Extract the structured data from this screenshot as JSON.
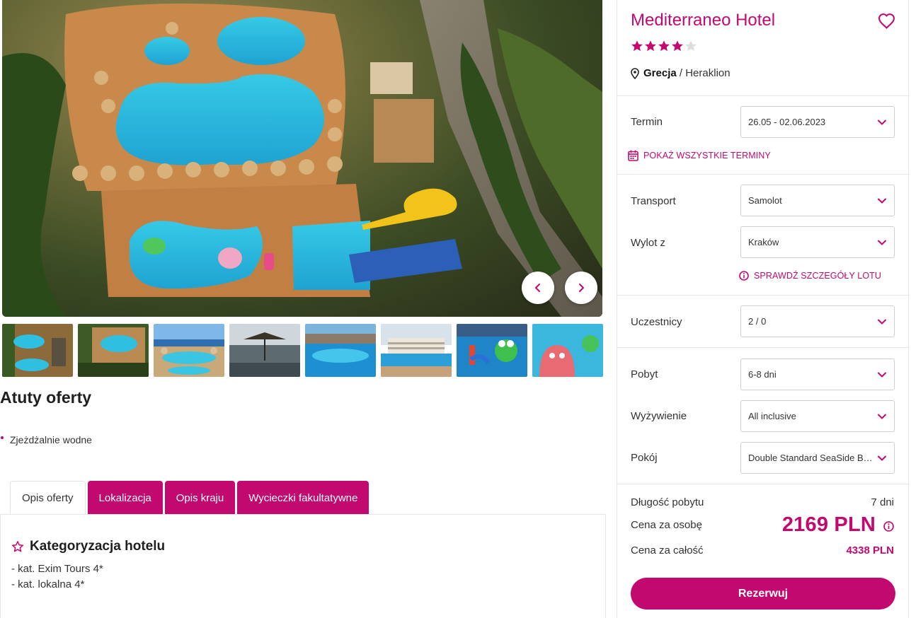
{
  "gallery": {
    "thumbnails": [
      {
        "name": "thumb-pool-aerial-1"
      },
      {
        "name": "thumb-pool-aerial-2"
      },
      {
        "name": "thumb-pool-sea-view"
      },
      {
        "name": "thumb-beach-umbrellas"
      },
      {
        "name": "thumb-pool-hotel-front"
      },
      {
        "name": "thumb-hotel-building-pool"
      },
      {
        "name": "thumb-kids-pool-frog"
      },
      {
        "name": "thumb-kids-pool-octopus"
      }
    ],
    "prev_icon": "chevron-left-icon",
    "next_icon": "chevron-right-icon"
  },
  "atuty": {
    "title": "Atuty oferty",
    "items": [
      "Zjeżdżalnie wodne"
    ]
  },
  "tabs": [
    {
      "label": "Opis oferty",
      "active": true
    },
    {
      "label": "Lokalizacja",
      "active": false
    },
    {
      "label": "Opis kraju",
      "active": false
    },
    {
      "label": "Wycieczki fakultatywne",
      "active": false
    }
  ],
  "content": {
    "section_title": "Kategoryzacja hotelu",
    "section_icon": "star-outline-icon",
    "lines": [
      "- kat. Exim Tours 4*",
      "- kat. lokalna 4*"
    ]
  },
  "hotel": {
    "name": "Mediterraneo Hotel",
    "stars_total": 5,
    "stars_filled": 4,
    "country": "Grecja",
    "separator": " / ",
    "city": "Heraklion"
  },
  "booking": {
    "termin_label": "Termin",
    "termin_value": "26.05 - 02.06.2023",
    "show_all_terms": "POKAŻ WSZYSTKIE TERMINY",
    "transport_label": "Transport",
    "transport_value": "Samolot",
    "wylot_label": "Wylot z",
    "wylot_value": "Kraków",
    "flight_details": "SPRAWDŹ SZCZEGÓŁY LOTU",
    "uczestnicy_label": "Uczestnicy",
    "uczestnicy_value": "2 / 0",
    "pobyt_label": "Pobyt",
    "pobyt_value": "6-8 dni",
    "wyzywienie_label": "Wyżywienie",
    "wyzywienie_value": "All inclusive",
    "pokoj_label": "Pokój",
    "pokoj_value": "Double Standard SeaSide Balcony"
  },
  "summary": {
    "duration_label": "Długość pobytu",
    "duration_value": "7 dni",
    "per_person_label": "Cena za osobę",
    "per_person_value": "2169 PLN",
    "total_label": "Cena za całość",
    "total_value": "4338 PLN",
    "book_label": "Rezerwuj"
  },
  "colors": {
    "accent": "#c2096f",
    "star_empty": "#dddddd"
  }
}
